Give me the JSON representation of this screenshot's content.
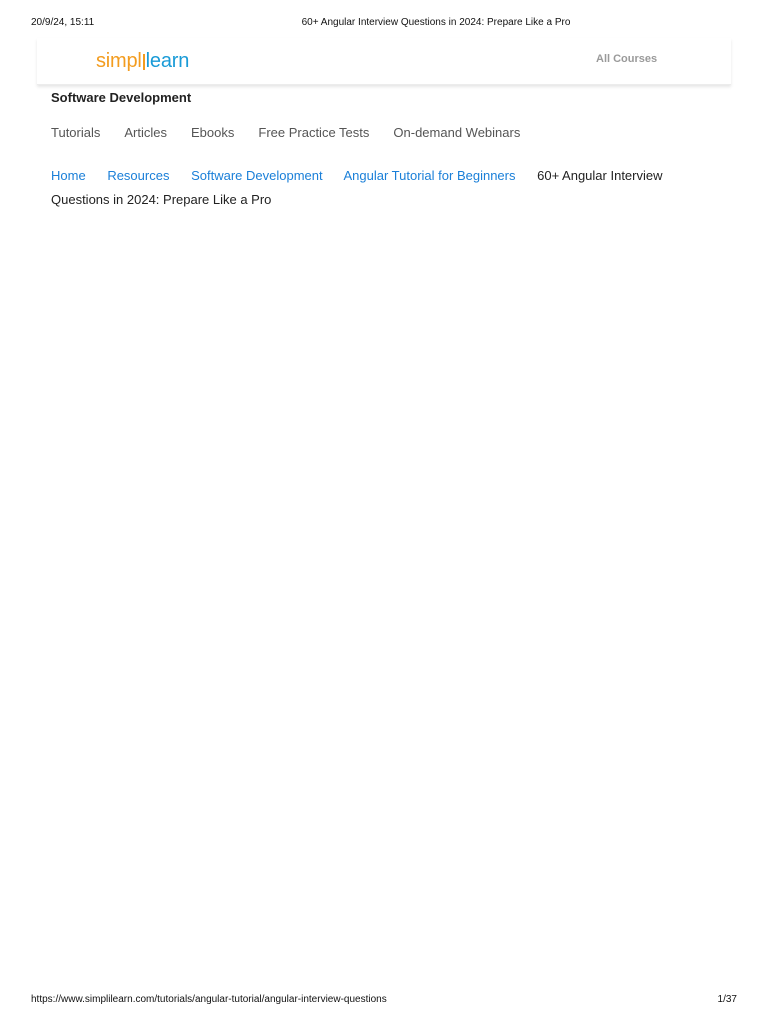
{
  "print_header": {
    "datetime": "20/9/24, 15:11",
    "page_title": "60+ Angular Interview Questions in 2024: Prepare Like a Pro"
  },
  "print_footer": {
    "url": "https://www.simplilearn.com/tutorials/angular-tutorial/angular-interview-questions",
    "page_count": "1/37"
  },
  "header": {
    "logo_part1": "simpl",
    "logo_part2": "learn",
    "all_courses_label": "All Courses"
  },
  "category": {
    "title": "Software Development"
  },
  "sub_nav": {
    "items": [
      {
        "label": "Tutorials"
      },
      {
        "label": "Articles"
      },
      {
        "label": "Ebooks"
      },
      {
        "label": "Free Practice Tests"
      },
      {
        "label": "On-demand Webinars"
      }
    ]
  },
  "breadcrumb": {
    "links": [
      {
        "label": "Home"
      },
      {
        "label": "Resources"
      },
      {
        "label": "Software Development"
      },
      {
        "label": "Angular Tutorial for Beginners"
      }
    ],
    "current": "60+ Angular Interview Questions in 2024: Prepare Like a Pro"
  },
  "colors": {
    "brand_orange": "#f39c1f",
    "brand_blue": "#1a9bd7",
    "link_blue": "#1a7fd8"
  }
}
